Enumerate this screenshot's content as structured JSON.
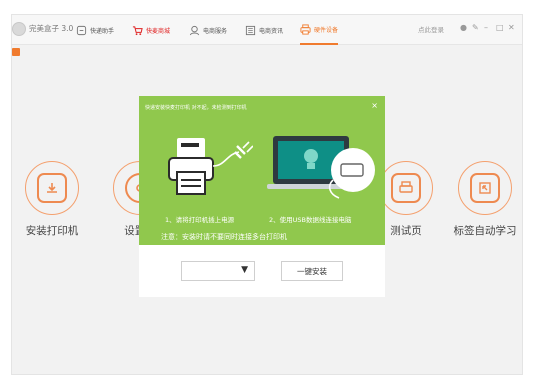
{
  "titlebar": {
    "app_title": "完美盒子 3.0",
    "nav": [
      {
        "label": "快递助手",
        "icon": "package-icon"
      },
      {
        "label": "快麦商城",
        "icon": "cart-icon"
      },
      {
        "label": "电商服务",
        "icon": "service-icon"
      },
      {
        "label": "电商资讯",
        "icon": "news-icon"
      },
      {
        "label": "硬件设备",
        "icon": "printer-icon"
      }
    ],
    "login": "点此登录",
    "controls": [
      "●",
      "✎",
      "–",
      "□",
      "✕"
    ]
  },
  "features": [
    {
      "label": "安装打印机",
      "icon": "install-printer-icon"
    },
    {
      "label": "设置打",
      "icon": "settings-gear-icon"
    },
    {
      "label": "测试页",
      "icon": "test-page-icon"
    },
    {
      "label": "标签自动学习",
      "icon": "label-learning-icon"
    }
  ],
  "dialog": {
    "title": "快递安装快麦打印机  对不起，未检测到打印机",
    "close": "×",
    "step1": "1、请将打印机插上电源",
    "step2": "2、使用USB数据线连接电脑",
    "note": "注意：安装时请不要同时连接多台打印机",
    "select_value": "",
    "select_arrow": "▼",
    "install_button": "一键安装"
  },
  "colors": {
    "accent": "#f07b2e",
    "dialog_green": "#90c84d",
    "store_red": "#e02222"
  }
}
